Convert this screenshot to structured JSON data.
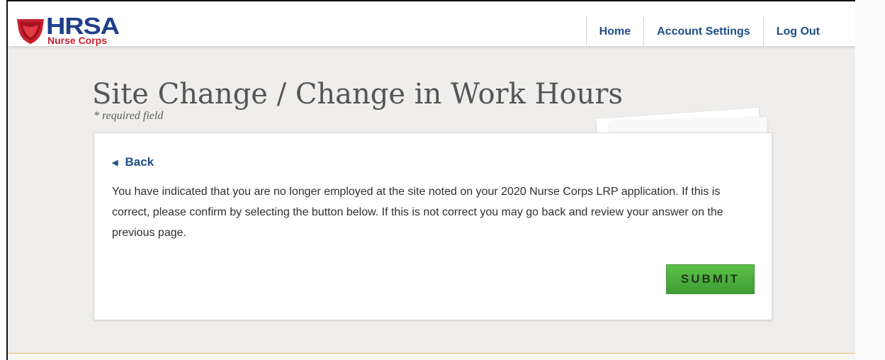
{
  "brand": {
    "main": "HRSA",
    "sub": "Nurse Corps",
    "colors": {
      "navy": "#1f3f8a",
      "red": "#c8202f"
    }
  },
  "nav": {
    "items": [
      {
        "label": "Home"
      },
      {
        "label": "Account Settings"
      },
      {
        "label": "Log Out"
      }
    ]
  },
  "page": {
    "title": "Site Change / Change in Work Hours",
    "required_note": "* required field"
  },
  "card": {
    "back_label": "Back",
    "back_icon": "triangle-left-icon",
    "message": "You have indicated that you are no longer employed at the site noted on your 2020 Nurse Corps LRP application. If this is correct, please confirm by selecting the button below. If this is not correct you may go back and review your answer on the previous page.",
    "submit_label": "SUBMIT",
    "submit_color": "#4caf3d"
  }
}
